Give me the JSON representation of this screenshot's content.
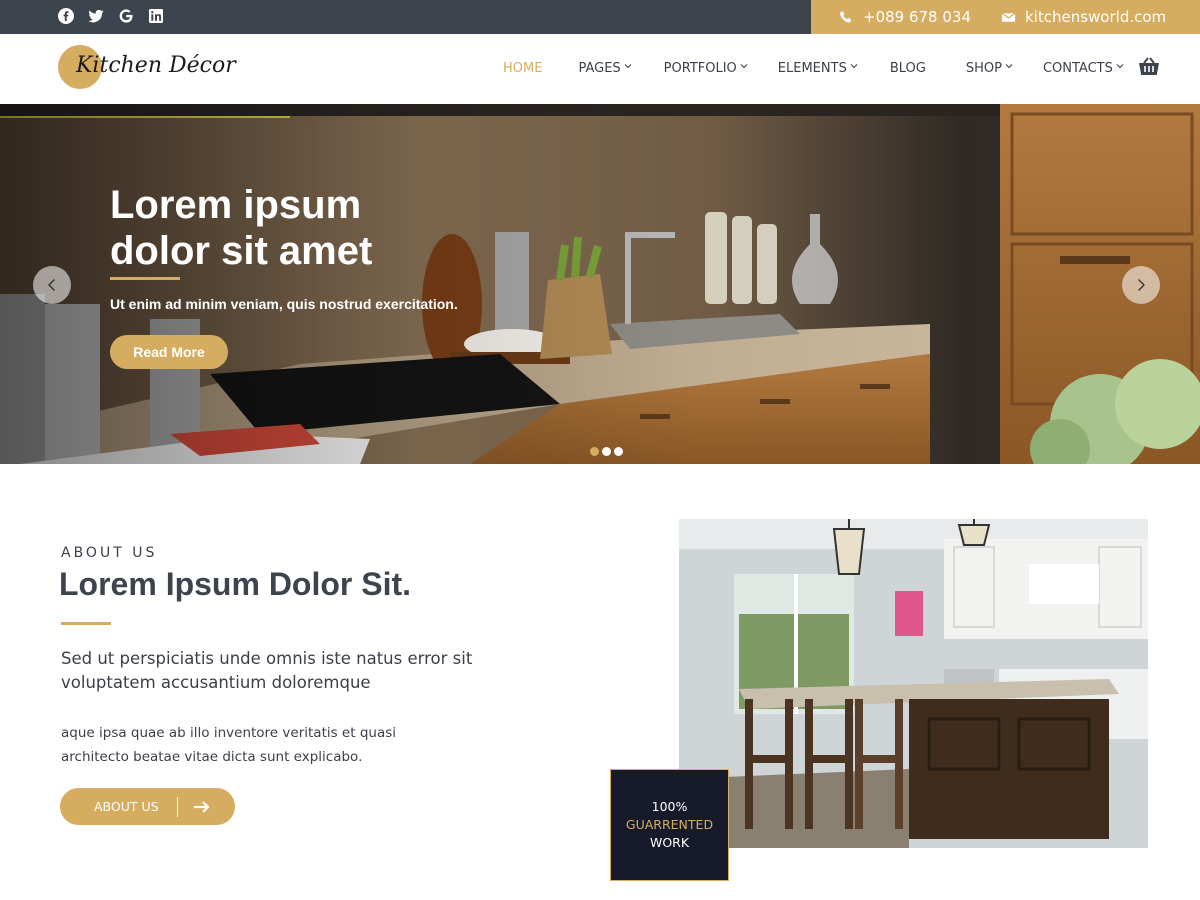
{
  "topbar": {
    "social": [
      "facebook-icon",
      "twitter-icon",
      "google-icon",
      "linkedin-icon"
    ],
    "phone": "+089 678 034",
    "email": "kitchensworld.com"
  },
  "header": {
    "logo_text": "Kitchen Décor",
    "nav": [
      {
        "label": "HOME",
        "active": true,
        "dropdown": false
      },
      {
        "label": "PAGES",
        "active": false,
        "dropdown": true
      },
      {
        "label": "PORTFOLIO",
        "active": false,
        "dropdown": true
      },
      {
        "label": "ELEMENTS",
        "active": false,
        "dropdown": true
      },
      {
        "label": "BLOG",
        "active": false,
        "dropdown": false
      },
      {
        "label": "SHOP",
        "active": false,
        "dropdown": true
      },
      {
        "label": "CONTACTS",
        "active": false,
        "dropdown": true
      }
    ],
    "cart_icon": "basket-icon"
  },
  "hero": {
    "title_line1": "Lorem ipsum",
    "title_line2": "dolor sit amet",
    "subtitle": "Ut enim ad minim veniam, quis nostrud exercitation.",
    "button": "Read More",
    "slides": 3,
    "active_slide": 0
  },
  "about": {
    "eyebrow": "ABOUT US",
    "title": "Lorem Ipsum Dolor Sit.",
    "lead": "Sed ut perspiciatis unde omnis iste natus error sit voluptatem accusantium doloremque",
    "body": "aque ipsa quae ab illo inventore veritatis et quasi architecto beatae vitae dicta sunt explicabo.",
    "button": "ABOUT US"
  },
  "badge": {
    "line1": "100%",
    "line2": "GUARRENTED",
    "line3": "WORK"
  },
  "colors": {
    "accent": "#d5ac60",
    "dark": "#3e444d",
    "navy": "#161a2b"
  }
}
